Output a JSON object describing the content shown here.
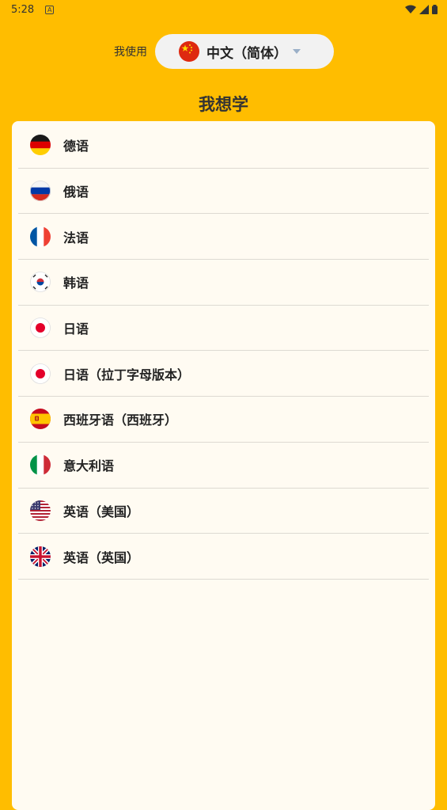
{
  "status_bar": {
    "time": "5:28",
    "notification_icon": "a-icon",
    "icons": [
      "wifi-icon",
      "signal-icon",
      "battery-icon"
    ]
  },
  "source": {
    "label": "我使用",
    "selected": "中文（简体）",
    "flag": "cn"
  },
  "section_title": "我想学",
  "languages": [
    {
      "label": "德语",
      "flag": "de"
    },
    {
      "label": "俄语",
      "flag": "ru"
    },
    {
      "label": "法语",
      "flag": "fr"
    },
    {
      "label": "韩语",
      "flag": "kr"
    },
    {
      "label": "日语",
      "flag": "jp"
    },
    {
      "label": "日语（拉丁字母版本）",
      "flag": "jp"
    },
    {
      "label": "西班牙语（西班牙）",
      "flag": "es"
    },
    {
      "label": "意大利语",
      "flag": "it"
    },
    {
      "label": "英语（美国）",
      "flag": "us"
    },
    {
      "label": "英语（英国）",
      "flag": "gb"
    }
  ],
  "colors": {
    "background": "#FFBD00",
    "card": "#FFFBF2",
    "divider": "#DDDAD2"
  }
}
